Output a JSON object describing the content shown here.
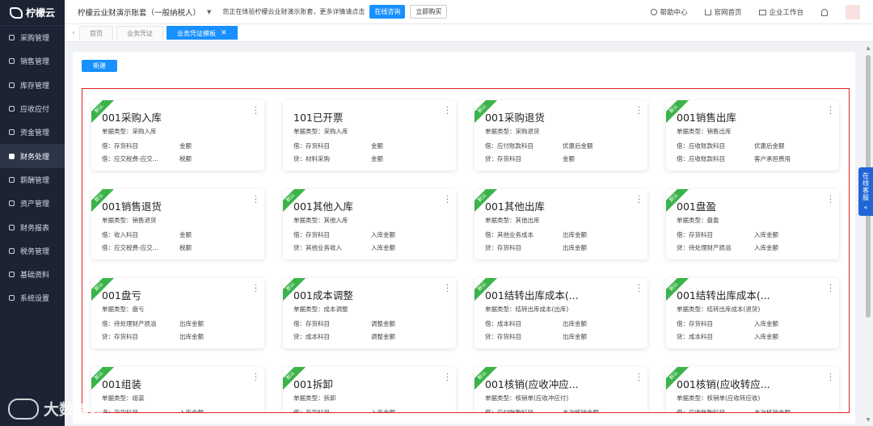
{
  "brand": {
    "name": "柠檬云"
  },
  "sidebar": {
    "items": [
      {
        "label": "采购管理",
        "icon": "cart-icon"
      },
      {
        "label": "销售管理",
        "icon": "sales-icon"
      },
      {
        "label": "库存管理",
        "icon": "inventory-icon"
      },
      {
        "label": "应收应付",
        "icon": "receivable-icon"
      },
      {
        "label": "资金管理",
        "icon": "fund-icon"
      },
      {
        "label": "财务处理",
        "icon": "finance-icon",
        "active": true
      },
      {
        "label": "薪酬管理",
        "icon": "salary-icon"
      },
      {
        "label": "资产管理",
        "icon": "asset-icon"
      },
      {
        "label": "财务报表",
        "icon": "report-icon"
      },
      {
        "label": "税务管理",
        "icon": "tax-icon"
      },
      {
        "label": "基础资料",
        "icon": "base-data-icon"
      },
      {
        "label": "系统设置",
        "icon": "settings-icon"
      }
    ]
  },
  "header": {
    "company": "柠檬云业财演示账套（一般纳税人）",
    "notice": "您正在体验柠檬云业财演示账套，更多详情请点击",
    "consult_button": "在线咨询",
    "buy_button": "立即购买",
    "help": "帮助中心",
    "official_site": "官网首页",
    "workspace": "企业工作台"
  },
  "tabs": [
    {
      "label": "首页",
      "active": false
    },
    {
      "label": "业务凭证",
      "active": false
    },
    {
      "label": "业务凭证模板",
      "active": true
    }
  ],
  "toolbar": {
    "new_button": "新建"
  },
  "ribbon_label": "默认",
  "cards": [
    {
      "title": "001采购入库",
      "default": true,
      "type": "单据类型：采购入库",
      "r1a": "借：存货科目",
      "r1b": "金额",
      "r2a": "借：应交税费-应交...",
      "r2b": "税额"
    },
    {
      "title": "101已开票",
      "default": false,
      "type": "单据类型：采购入库",
      "r1a": "借：存货科目",
      "r1b": "金额",
      "r2a": "贷：材料采购",
      "r2b": "金额"
    },
    {
      "title": "001采购退货",
      "default": true,
      "type": "单据类型：采购退货",
      "r1a": "借：应付账款科目",
      "r1b": "优惠后金额",
      "r2a": "贷：存货科目",
      "r2b": "金额"
    },
    {
      "title": "001销售出库",
      "default": true,
      "type": "单据类型：销售出库",
      "r1a": "借：应收账款科目",
      "r1b": "优惠后金额",
      "r2a": "借：应收账款科目",
      "r2b": "客户承担费用"
    },
    {
      "title": "001销售退货",
      "default": true,
      "type": "单据类型：销售退货",
      "r1a": "借：收入科目",
      "r1b": "金额",
      "r2a": "借：应交税费-应交...",
      "r2b": "税额"
    },
    {
      "title": "001其他入库",
      "default": true,
      "type": "单据类型：其他入库",
      "r1a": "借：存货科目",
      "r1b": "入库金额",
      "r2a": "贷：其他业务收入",
      "r2b": "入库金额"
    },
    {
      "title": "001其他出库",
      "default": true,
      "type": "单据类型：其他出库",
      "r1a": "借：其他业务成本",
      "r1b": "出库金额",
      "r2a": "贷：存货科目",
      "r2b": "出库金额"
    },
    {
      "title": "001盘盈",
      "default": true,
      "type": "单据类型：盘盈",
      "r1a": "借：存货科目",
      "r1b": "入库金额",
      "r2a": "贷：待处理财产损溢",
      "r2b": "入库金额"
    },
    {
      "title": "001盘亏",
      "default": true,
      "type": "单据类型：盘亏",
      "r1a": "借：待处理财产损溢",
      "r1b": "出库金额",
      "r2a": "贷：存货科目",
      "r2b": "出库金额"
    },
    {
      "title": "001成本调整",
      "default": true,
      "type": "单据类型：成本调整",
      "r1a": "借：存货科目",
      "r1b": "调整金额",
      "r2a": "贷：成本科目",
      "r2b": "调整金额"
    },
    {
      "title": "001结转出库成本(...",
      "default": true,
      "type": "单据类型：结转出库成本(出库)",
      "r1a": "借：成本科目",
      "r1b": "出库金额",
      "r2a": "贷：存货科目",
      "r2b": "出库金额"
    },
    {
      "title": "001结转出库成本(...",
      "default": true,
      "type": "单据类型：结转出库成本(退货)",
      "r1a": "借：存货科目",
      "r1b": "入库金额",
      "r2a": "贷：成本科目",
      "r2b": "入库金额"
    },
    {
      "title": "001组装",
      "default": true,
      "type": "单据类型：组装",
      "r1a": "借：存货科目",
      "r1b": "入库金额",
      "r2a": "",
      "r2b": ""
    },
    {
      "title": "001拆卸",
      "default": true,
      "type": "单据类型：拆卸",
      "r1a": "借：存货科目",
      "r1b": "入库金额",
      "r2a": "",
      "r2b": ""
    },
    {
      "title": "001核销(应收冲应...",
      "default": true,
      "type": "单据类型：核销单(应收冲应付)",
      "r1a": "借：应付账款科目",
      "r1b": "本次核销金额",
      "r2a": "",
      "r2b": ""
    },
    {
      "title": "001核销(应收转应...",
      "default": true,
      "type": "单据类型：核销单(应收转应收)",
      "r1a": "借：应收账款科目",
      "r1b": "本次核销金额",
      "r2a": "",
      "r2b": ""
    }
  ],
  "service": {
    "label": "在线客服"
  },
  "watermark": {
    "text": "大数跨境"
  },
  "colors": {
    "primary": "#1890ff",
    "sidebar": "#1c2434",
    "ribbon": "#3bb34a",
    "frame": "#e02020"
  }
}
